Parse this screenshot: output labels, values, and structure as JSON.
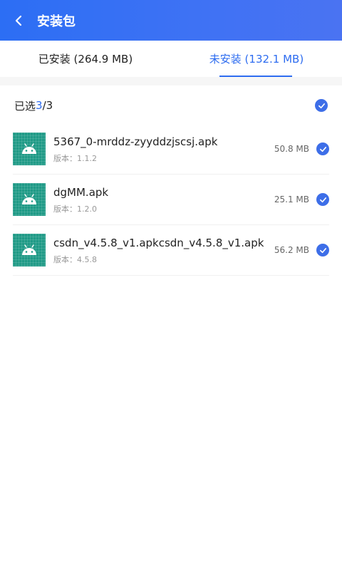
{
  "header": {
    "title": "安装包",
    "back_icon": "chevron-left-icon"
  },
  "tabs": [
    {
      "label": "已安装 (264.9 MB)",
      "active": false
    },
    {
      "label": "未安装 (132.1 MB)",
      "active": true
    }
  ],
  "summary": {
    "prefix": "已选",
    "selected": "3",
    "total": "/3",
    "select_all_checked": true
  },
  "items": [
    {
      "name": "5367_0-mrddz-zyyddzjscsj.apk",
      "version": "版本：1.1.2",
      "size": "50.8 MB",
      "checked": true
    },
    {
      "name": "dgMM.apk",
      "version": "版本：1.2.0",
      "size": "25.1 MB",
      "checked": true
    },
    {
      "name": "csdn_v4.5.8_v1.apkcsdn_v4.5.8_v1.apk",
      "version": "版本：4.5.8",
      "size": "56.2 MB",
      "checked": true
    }
  ],
  "colors": {
    "accent": "#2d6cf0",
    "header_start": "#2c6ef4",
    "header_end": "#4a73f2",
    "icon_bg": "#1f9a86",
    "check": "#3d6ee8"
  }
}
